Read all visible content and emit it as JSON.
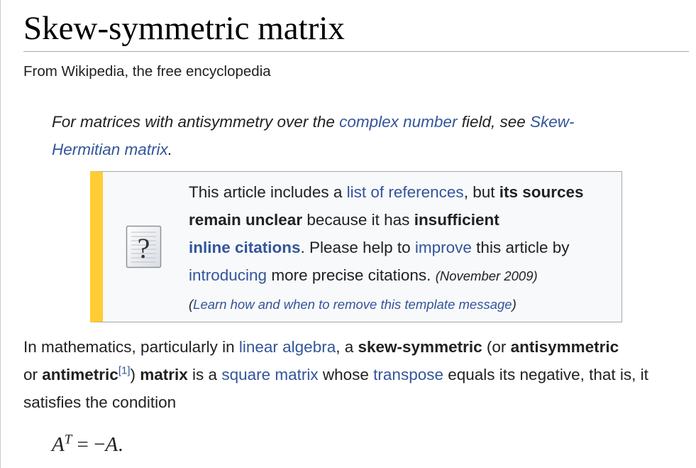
{
  "page_title": "Skew-symmetric matrix",
  "tagline": "From Wikipedia, the free encyclopedia",
  "hatnote": {
    "text_before": "For matrices with antisymmetry over the ",
    "link1": "complex number",
    "text_middle": " field, see ",
    "link2": "Skew-Hermitian matrix",
    "text_after": "."
  },
  "ambox": {
    "icon": "question-mark-document-icon",
    "t1": "This article includes a ",
    "link_refs": "list of references",
    "t2": ", but ",
    "b1": "its sources remain unclear",
    "t3": " because it has ",
    "b2": "insufficient",
    "link_inline": "inline citations",
    "t4": ". Please help to ",
    "link_improve": "improve",
    "t5": " this article by ",
    "link_introducing": "introducing",
    "t6": " more precise citations.",
    "date": "(November 2009)",
    "learn_open": "(",
    "learn_link": "Learn how and when to remove this template message",
    "learn_close": ")",
    "accent_color": "#ffcc33"
  },
  "paragraph": {
    "t1": "In mathematics, particularly in ",
    "link_linear_algebra": "linear algebra",
    "t2": ", a ",
    "b_skew": "skew-symmetric",
    "t3": " (or ",
    "b_antisym": "antisymmetric",
    "t4": " or ",
    "b_antimetric": "antimetric",
    "ref": "[1]",
    "t5": ") ",
    "b_matrix": "matrix",
    "t6": " is a ",
    "link_square_matrix": "square matrix",
    "t7": " whose ",
    "link_transpose": "transpose",
    "t8": " equals its negative, that is, it satisfies the condition"
  },
  "formula": {
    "lhs": "A",
    "sup": "T",
    "eq": " = −",
    "rhs": "A",
    "end": "."
  }
}
